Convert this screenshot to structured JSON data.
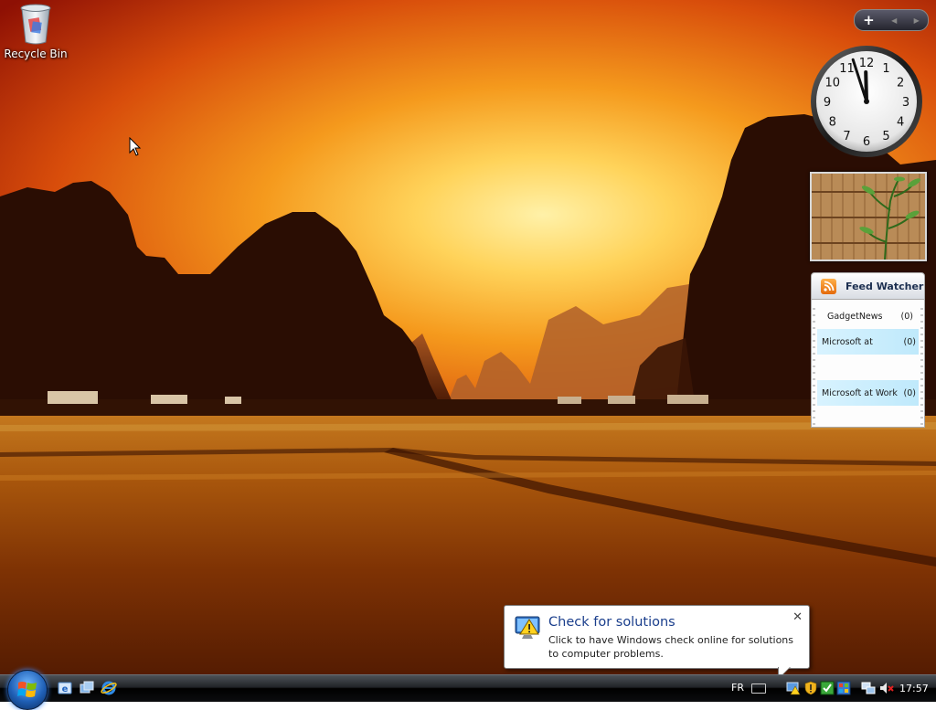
{
  "desktop": {
    "recycle_bin_label": "Recycle Bin"
  },
  "sidebar": {
    "controls": {
      "add": "+",
      "prev": "◀",
      "next": "▶"
    },
    "clock": {
      "hour": 11,
      "minute": 57
    },
    "feed_watcher": {
      "title": "Feed Watcher",
      "feeds": [
        {
          "name": "GadgetNews",
          "count": "(0)",
          "highlighted": false
        },
        {
          "name": "Microsoft at",
          "count": "(0)",
          "highlighted": true
        },
        {
          "name": "",
          "count": "",
          "highlighted": false
        },
        {
          "name": "Microsoft at Work",
          "count": "(0)",
          "highlighted": true
        }
      ]
    }
  },
  "notification": {
    "title": "Check for solutions",
    "text": "Click to have Windows check online for solutions to computer problems.",
    "close": "✕"
  },
  "taskbar": {
    "language": "FR",
    "time": "17:57"
  },
  "colors": {
    "sky_top": "#b51a05",
    "sky_glow": "#ffd35a",
    "field": "#8a3a05",
    "taskbar": "#1a1c1f",
    "balloon_title": "#1a3e8c"
  }
}
